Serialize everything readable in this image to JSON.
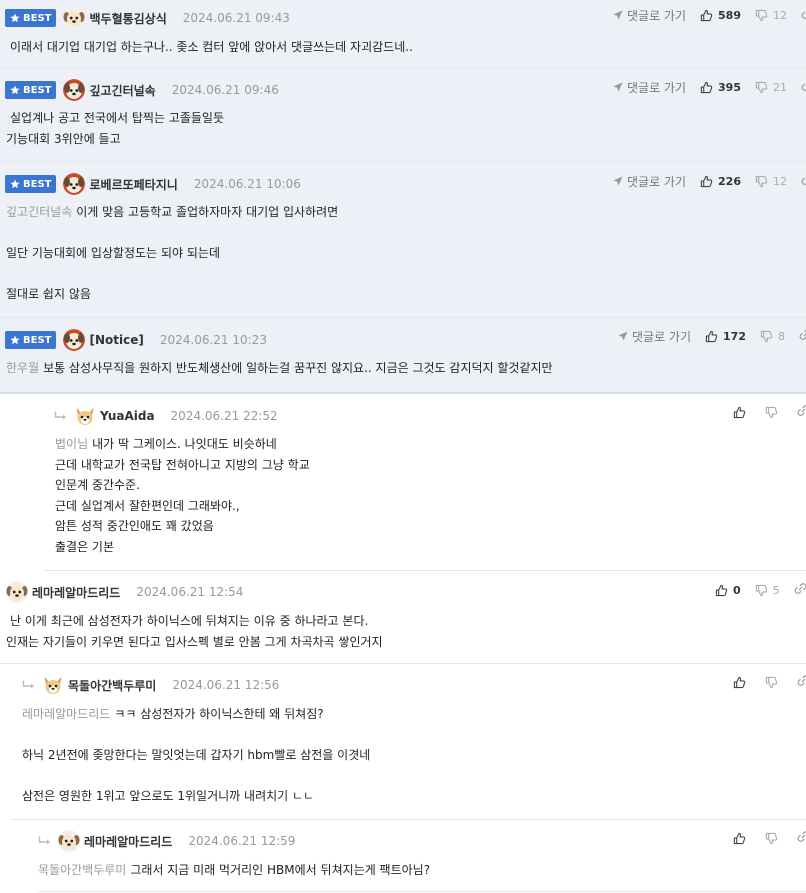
{
  "labels": {
    "best": "BEST",
    "reply_to": "댓글로 가기"
  },
  "comments": [
    {
      "best": true,
      "nick": "백두혈통김상식",
      "date": "2024.06.21 09:43",
      "up": "589",
      "down": "12",
      "mention": "",
      "text": "이래서 대기업 대기업 하는구나.. 좆소 컴터 앞에 앉아서 댓글쓰는데 자괴감드네.."
    },
    {
      "best": true,
      "nick": "깊고긴터널속",
      "date": "2024.06.21 09:46",
      "up": "395",
      "down": "21",
      "mention": "",
      "text": "실업계나 공고 전국에서 탑찍는 고졸들일듯\n기능대회 3위안에 들고"
    },
    {
      "best": true,
      "nick": "로베르또페타지니",
      "date": "2024.06.21 10:06",
      "up": "226",
      "down": "12",
      "mention": "깊고긴터널속",
      "text": "이게 맞음 고등학교 졸업하자마자 대기업 입사하려면\n\n일단 기능대회에 입상할정도는 되야 되는데\n\n절대로 쉽지 않음"
    },
    {
      "best": true,
      "nick": "[Notice]",
      "date": "2024.06.21 10:23",
      "up": "172",
      "down": "8",
      "mention": "한우월",
      "text": "보통 삼성사무직을 원하지 반도체생산에 일하는걸 꿈꾸진 않지요.. 지금은 그것도 감지덕지 할것같지만"
    },
    {
      "best": false,
      "nick": "YuaAida",
      "date": "2024.06.21 22:52",
      "up": "",
      "down": "",
      "mention": "볍이님",
      "text": "내가 딱 그케이스. 나잇대도 비슷하네\n근데 내학교가 전국탑 전혀아니고 지방의 그냥 학교\n인문계 중간수준.\n근데 실업계서 잘한편인데 그래봐야.,\n암튼 성적 중간인애도 꽤 갔었음\n출결은 기본"
    },
    {
      "best": false,
      "nick": "레마레알마드리드",
      "date": "2024.06.21 12:54",
      "up": "0",
      "down": "5",
      "mention": "",
      "text": "난 이게 최근에 삼성전자가 하이닉스에 뒤쳐지는 이유 중 하나라고 본다.\n인재는 자기들이 키우면 된다고 입사스펙 별로 안봄 그게 차곡차곡 쌓인거지"
    },
    {
      "best": false,
      "nick": "목돌아간백두루미",
      "date": "2024.06.21 12:56",
      "up": "",
      "down": "",
      "mention": "레마레알마드리드",
      "text": "ㅋㅋ 삼성전자가 하이닉스한테 왜 뒤쳐짐?\n\n하닉 2년전에 좆망한다는 말잇엇는데 갑자기 hbm빨로 삼전을 이겻네\n\n삼전은 영원한 1위고 앞으로도 1위일거니까 내려치기 ㄴㄴ"
    },
    {
      "best": false,
      "nick": "레마레알마드리드",
      "date": "2024.06.21 12:59",
      "up": "",
      "down": "",
      "mention": "목돌아간백두루미",
      "text": "그래서 지금 미래 먹거리인 HBM에서 뒤쳐지는게 팩트아님?"
    }
  ]
}
